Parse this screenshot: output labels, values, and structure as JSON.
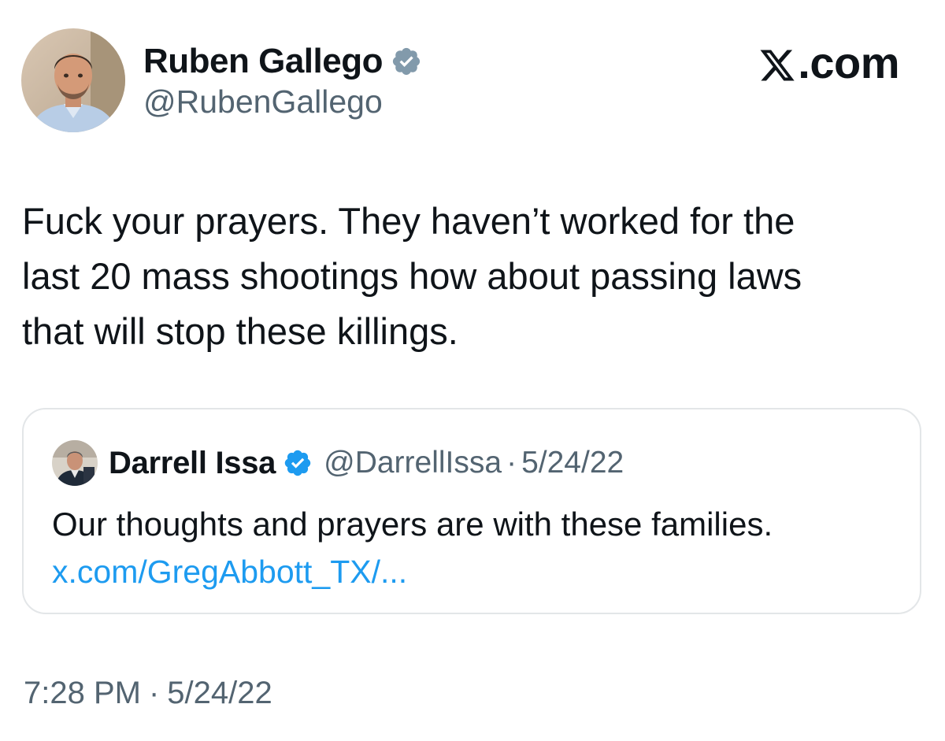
{
  "author": {
    "display_name": "Ruben Gallego",
    "handle": "@RubenGallego",
    "verified_icon": "verified-badge-icon",
    "avatar": "avatar"
  },
  "brand": {
    "label": ".com",
    "logo_icon": "x-logo-icon"
  },
  "tweet": {
    "text": "Fuck your prayers.  They haven’t worked for the\nlast 20 mass shootings how about passing laws\nthat will stop these killings."
  },
  "quoted_tweet": {
    "display_name": "Darrell Issa",
    "handle": "@DarrellIssa",
    "separator": "·",
    "date": "5/24/22",
    "text": "Our thoughts and prayers are with these families.",
    "link": "x.com/GregAbbott_TX/..."
  },
  "footer": {
    "time": "7:28 PM",
    "separator": "·",
    "date": "5/24/22"
  },
  "colors": {
    "text_primary": "#0f1419",
    "text_secondary": "#536471",
    "link": "#1d9bf0",
    "border": "#e3e6e8",
    "badge_author": "#829aab",
    "badge_quoted": "#1d9bf0"
  }
}
